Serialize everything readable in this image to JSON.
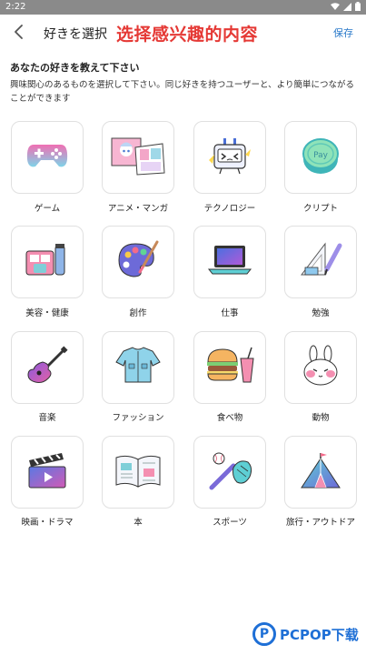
{
  "status_bar": {
    "time": "2:22"
  },
  "app_bar": {
    "title": "好きを選択",
    "overlay_title": "选择感兴趣的内容",
    "save_label": "保存"
  },
  "intro": {
    "heading": "あなたの好きを教えて下さい",
    "text": "興味関心のあるものを選択して下さい。同じ好きを持つユーザーと、より簡単につながることができます"
  },
  "categories": [
    {
      "label": "ゲーム",
      "icon": "game-controller-icon"
    },
    {
      "label": "アニメ・マンガ",
      "icon": "anime-manga-icon"
    },
    {
      "label": "テクノロジー",
      "icon": "technology-robot-icon"
    },
    {
      "label": "クリプト",
      "icon": "crypto-coin-icon"
    },
    {
      "label": "美容・健康",
      "icon": "cosmetics-icon"
    },
    {
      "label": "創作",
      "icon": "palette-icon"
    },
    {
      "label": "仕事",
      "icon": "laptop-icon"
    },
    {
      "label": "勉強",
      "icon": "study-tools-icon"
    },
    {
      "label": "音楽",
      "icon": "guitar-icon"
    },
    {
      "label": "ファッション",
      "icon": "clothes-icon"
    },
    {
      "label": "食べ物",
      "icon": "food-icon"
    },
    {
      "label": "動物",
      "icon": "animal-bunny-icon"
    },
    {
      "label": "映画・ドラマ",
      "icon": "clapperboard-icon"
    },
    {
      "label": "本",
      "icon": "open-book-icon"
    },
    {
      "label": "スポーツ",
      "icon": "baseball-icon"
    },
    {
      "label": "旅行・アウトドア",
      "icon": "tent-icon"
    }
  ],
  "watermark": {
    "letter": "P",
    "text": "PCPOP下载"
  }
}
